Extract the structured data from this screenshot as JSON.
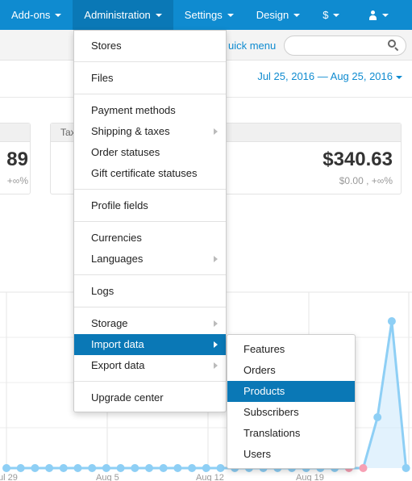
{
  "nav": {
    "items": [
      {
        "label": "Add-ons"
      },
      {
        "label": "Administration"
      },
      {
        "label": "Settings"
      },
      {
        "label": "Design"
      },
      {
        "label": "$"
      }
    ]
  },
  "header": {
    "quick_menu": "uick menu",
    "search_placeholder": "",
    "date_range": "Jul 25, 2016 — Aug 25, 2016"
  },
  "cards": {
    "left": {
      "value": "89",
      "sub": "+∞%"
    },
    "right": {
      "title": "Tax",
      "value": "$340.63",
      "sub": "$0.00 , +∞%"
    }
  },
  "chart_data": {
    "type": "area",
    "x_tick_labels": [
      "ul 29",
      "Aug 5",
      "Aug 12",
      "Aug 19"
    ],
    "colors": {
      "line": "#8ecff5",
      "fill": "#cfeafb",
      "marker": "#8ecff5",
      "alt_marker": "#f7a0b4"
    }
  },
  "admin_menu": {
    "items": [
      {
        "label": "Stores"
      },
      {
        "label": "Files"
      },
      {
        "label": "Payment methods"
      },
      {
        "label": "Shipping & taxes"
      },
      {
        "label": "Order statuses"
      },
      {
        "label": "Gift certificate statuses"
      },
      {
        "label": "Profile fields"
      },
      {
        "label": "Currencies"
      },
      {
        "label": "Languages"
      },
      {
        "label": "Logs"
      },
      {
        "label": "Storage"
      },
      {
        "label": "Import data"
      },
      {
        "label": "Export data"
      },
      {
        "label": "Upgrade center"
      }
    ]
  },
  "import_submenu": {
    "items": [
      {
        "label": "Features"
      },
      {
        "label": "Orders"
      },
      {
        "label": "Products"
      },
      {
        "label": "Subscribers"
      },
      {
        "label": "Translations"
      },
      {
        "label": "Users"
      }
    ]
  }
}
